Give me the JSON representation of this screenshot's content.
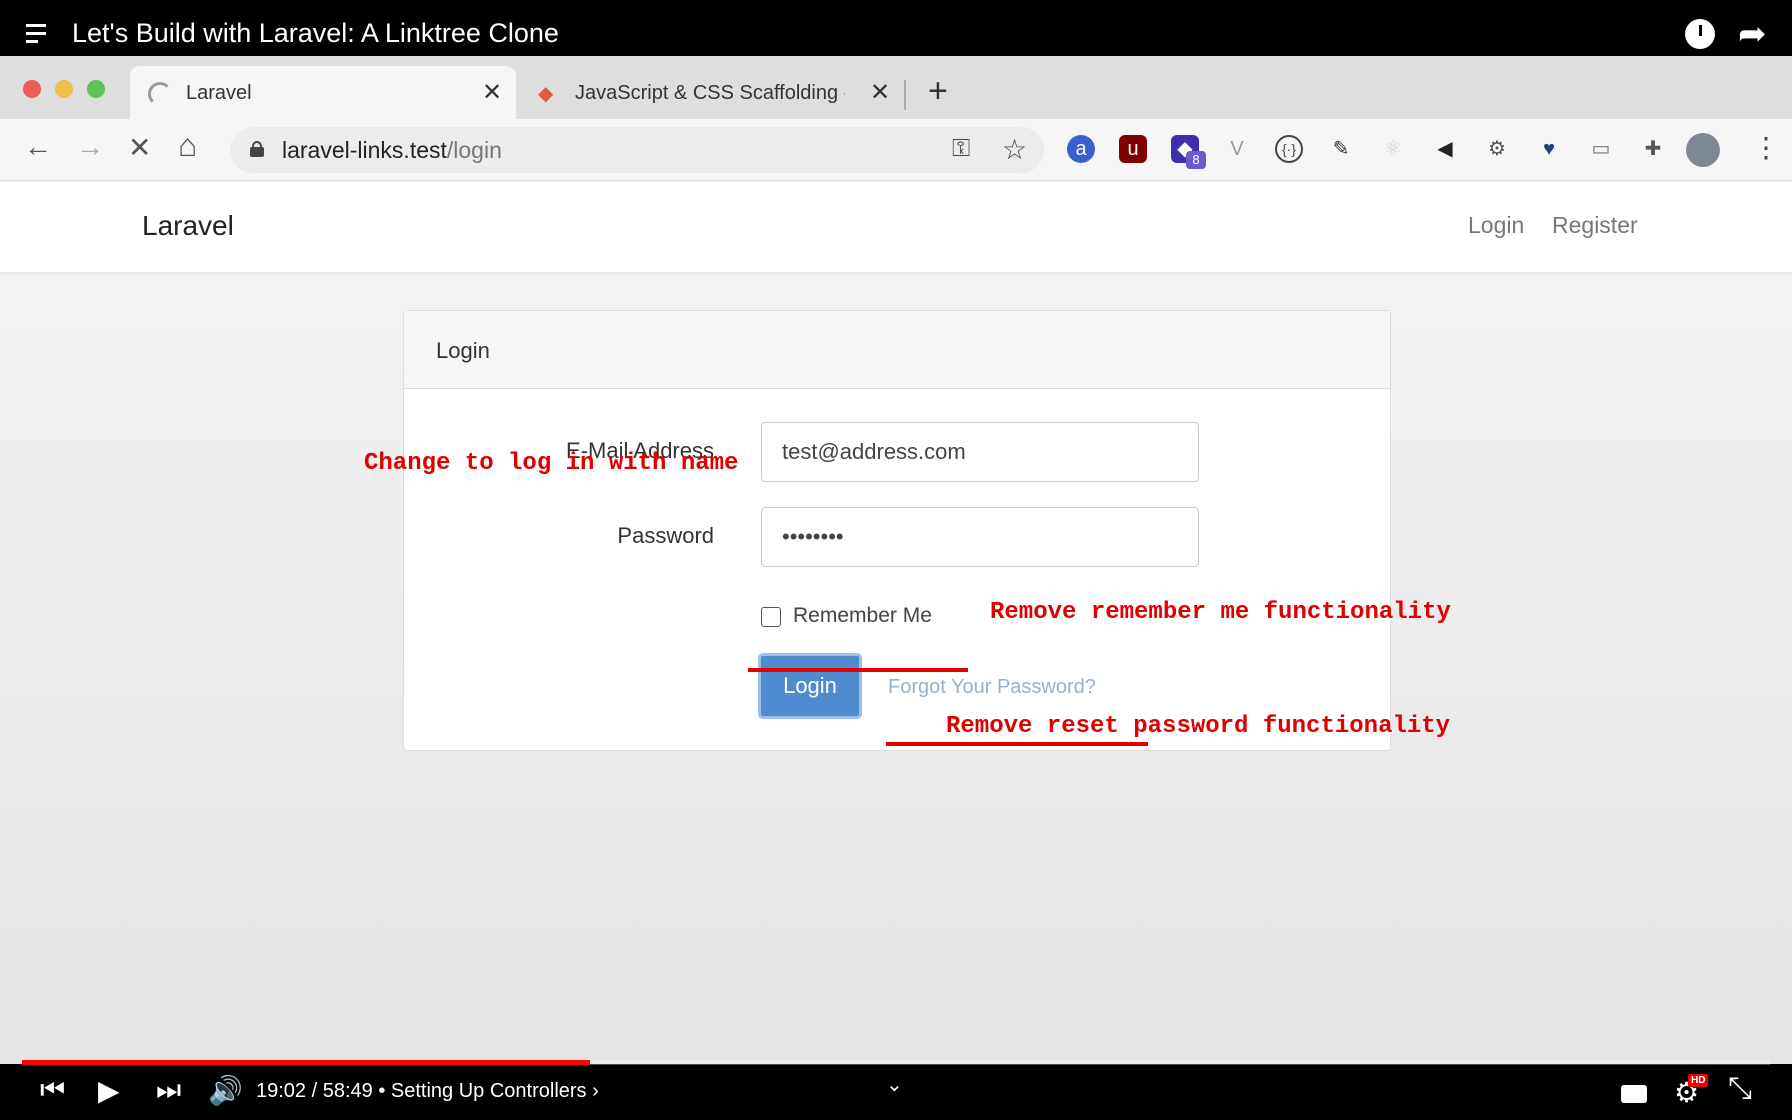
{
  "yt_player": {
    "video_title": "Let's Build with Laravel: A Linktree Clone",
    "time_display": "19:02 / 58:49",
    "chapter": "• Setting Up Controllers ›",
    "progress": 0.325,
    "hd_badge": "HD"
  },
  "browser": {
    "tabs": [
      {
        "label": "Laravel",
        "active": true,
        "close": "✕"
      },
      {
        "label": "JavaScript & CSS Scaffolding -",
        "active": false,
        "close": "✕"
      }
    ],
    "new_tab": "+",
    "url_host": "laravel-links.test",
    "url_path": "/login",
    "nav_icons": {
      "back": "←",
      "forward": "→",
      "stop": "✕",
      "home": "⌂"
    },
    "extension_count_badge": "8",
    "extension_icons": [
      "amazon-assistant-icon",
      "ublock-icon",
      "extension-8-icon",
      "vue-devtools-icon",
      "json-formatter-icon",
      "color-picker-icon",
      "react-devtools-icon",
      "audio-icon",
      "settings-ext-icon",
      "bitwarden-icon",
      "screen-icon",
      "puzzle-icon"
    ]
  },
  "page": {
    "brand": "Laravel",
    "nav_links": [
      "Login",
      "Register"
    ],
    "card_title": "Login",
    "email_label": "E-Mail Address",
    "email_value": "test@address.com",
    "password_label": "Password",
    "password_value": "••••••••",
    "remember_label": "Remember Me",
    "login_button": "Login",
    "forgot_link": "Forgot Your Password?"
  },
  "annotations": {
    "email_note": "Change to log in with name",
    "remember_note": "Remove remember me functionality",
    "forgot_note": "Remove reset password functionality"
  },
  "colors": {
    "annotation_red": "#e20000",
    "login_button_blue": "#4f8bcf",
    "progress_red": "#ff0000"
  }
}
